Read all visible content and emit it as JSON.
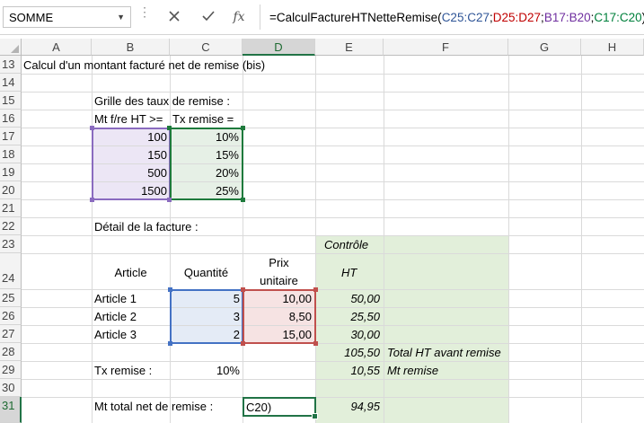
{
  "formula_bar": {
    "name_box": "SOMME",
    "formula_prefix": "=CalculFactureHTNetteRemise(",
    "ref1": "C25:C27",
    "ref2": "D25:D27",
    "ref3": "B17:B20",
    "ref4": "C17:C20",
    "sep": ";",
    "close": ")",
    "cancel_icon": "close-icon",
    "enter_icon": "check-icon",
    "fx_label": "fx"
  },
  "columns": [
    "A",
    "B",
    "C",
    "D",
    "E",
    "F",
    "G",
    "H"
  ],
  "rows": [
    "13",
    "14",
    "15",
    "16",
    "17",
    "18",
    "19",
    "20",
    "21",
    "22",
    "23",
    "24",
    "25",
    "26",
    "27",
    "28",
    "29",
    "30",
    "31"
  ],
  "active_cell": {
    "column": "D",
    "row": "31",
    "edit_text": "C20)"
  },
  "cells": {
    "a13": "Calcul d'un montant facturé net de remise (bis)",
    "b15": "Grille des taux de remise :",
    "b16": "Mt f/re HT >=",
    "c16": "Tx remise =",
    "grid_amounts": [
      "100",
      "150",
      "500",
      "1500"
    ],
    "grid_rates": [
      "10%",
      "15%",
      "20%",
      "25%"
    ],
    "b22": "Détail de la facture :",
    "e23": "Contrôle",
    "b24": "Article",
    "c24": "Quantité",
    "d24_line1": "Prix",
    "d24_line2": "unitaire",
    "e24": "HT",
    "articles": [
      {
        "name": "Article 1",
        "qty": "5",
        "price": "10,00",
        "ht": "50,00"
      },
      {
        "name": "Article 2",
        "qty": "3",
        "price": "8,50",
        "ht": "25,50"
      },
      {
        "name": "Article 3",
        "qty": "2",
        "price": "15,00",
        "ht": "30,00"
      }
    ],
    "e28": "105,50",
    "f28": "Total HT avant remise",
    "b29": "Tx remise :",
    "c29": "10%",
    "e29": "10,55",
    "f29": "Mt remise",
    "b31": "Mt total net de remise :",
    "e31": "94,95"
  },
  "colors": {
    "header_selected": "#217346",
    "control_fill": "#e2efda",
    "range_blue": "#4472c4",
    "range_red": "#c0504d",
    "range_purple": "#7030a0",
    "range_green": "#00803c"
  }
}
